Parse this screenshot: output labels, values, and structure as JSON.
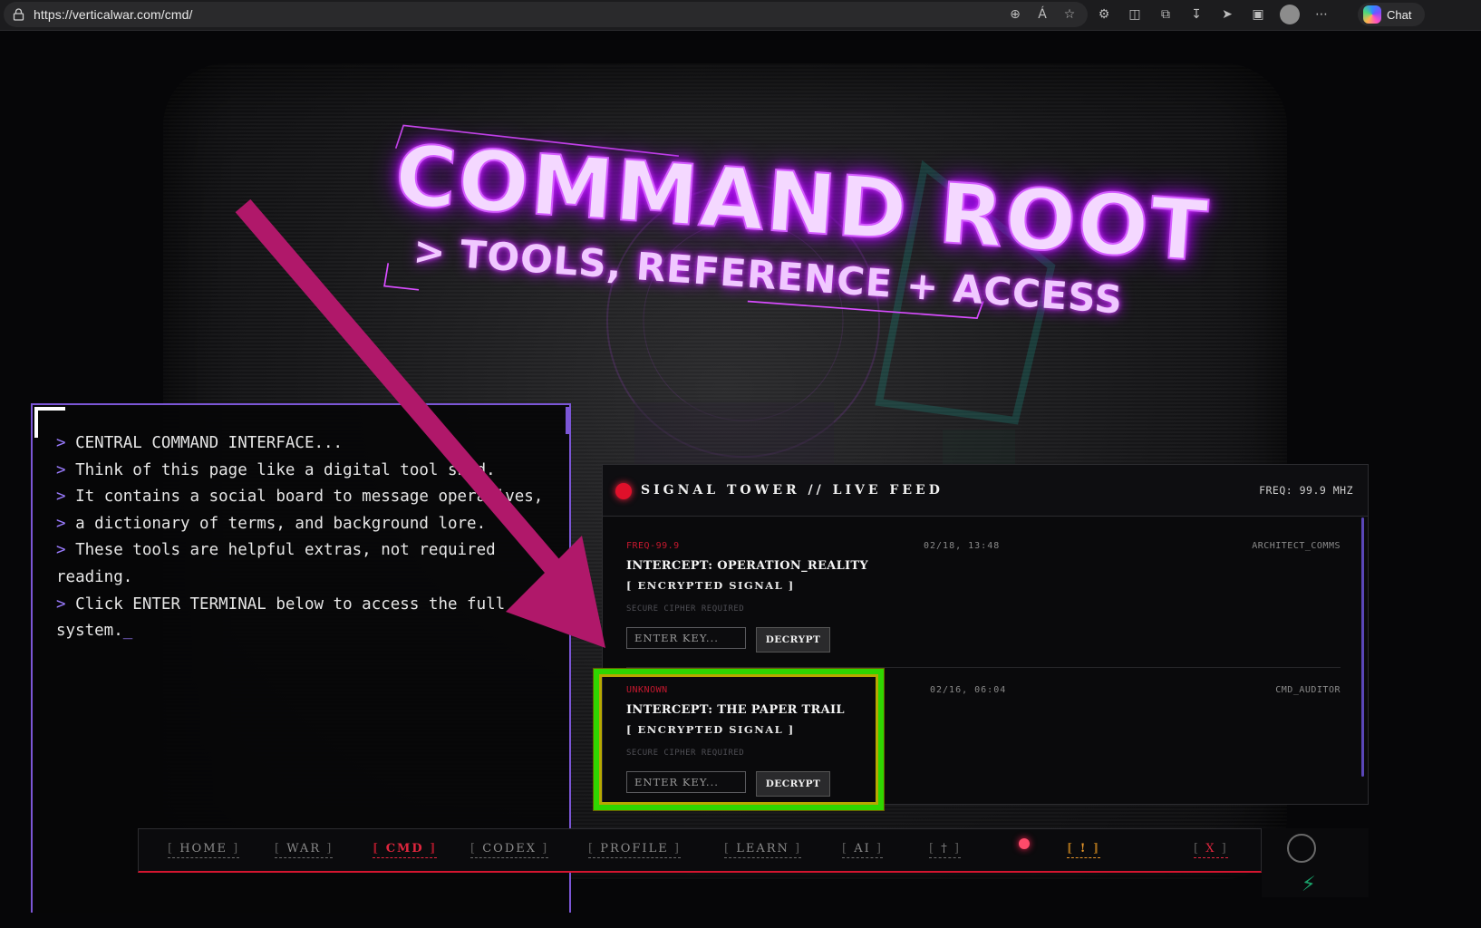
{
  "browser": {
    "url": "https://verticalwar.com/cmd/",
    "chat_label": "Chat",
    "more_label": "⋯"
  },
  "hero": {
    "title": "COMMAND ROOT",
    "subtitle": "> TOOLS, REFERENCE + ACCESS"
  },
  "terminal": {
    "lines": [
      {
        "prompt": ">",
        "text": " CENTRAL COMMAND INTERFACE..."
      },
      {
        "prompt": ">",
        "text": " Think of this page like a digital tool shed."
      },
      {
        "prompt": ">",
        "text": " It contains a social board to message operatives,"
      },
      {
        "prompt": ">",
        "text": " a dictionary of terms, and background lore."
      },
      {
        "prompt": ">",
        "text": " These tools are helpful extras, not required reading."
      },
      {
        "prompt": ">",
        "text": " Click ENTER TERMINAL below to access the full system."
      }
    ],
    "cursor": "_"
  },
  "signal_tower": {
    "title": "SIGNAL TOWER // LIVE FEED",
    "freq": "FREQ: 99.9 MHZ",
    "intercepts": [
      {
        "freq": "FREQ-99.9",
        "date": "02/18, 13:48",
        "author": "ARCHITECT_COMMS",
        "title": "INTERCEPT: OPERATION_REALITY",
        "status": "[ ENCRYPTED SIGNAL ]",
        "note": "SECURE CIPHER REQUIRED",
        "key_placeholder": "ENTER KEY...",
        "button": "DECRYPT"
      },
      {
        "freq": "UNKNOWN",
        "date": "02/16, 06:04",
        "author": "CMD_AUDITOR",
        "title": "INTERCEPT: THE PAPER TRAIL",
        "status": "[ ENCRYPTED SIGNAL ]",
        "note": "SECURE CIPHER REQUIRED",
        "key_placeholder": "ENTER KEY...",
        "button": "DECRYPT"
      }
    ]
  },
  "nav": {
    "items": [
      {
        "label": "HOME",
        "state": "normal"
      },
      {
        "label": "WAR",
        "state": "normal"
      },
      {
        "label": "CMD",
        "state": "active"
      },
      {
        "label": "CODEX",
        "state": "normal"
      },
      {
        "label": "PROFILE",
        "state": "normal"
      },
      {
        "label": "LEARN",
        "state": "normal"
      },
      {
        "label": "AI",
        "state": "normal"
      },
      {
        "label": "†",
        "state": "normal"
      },
      {
        "label": "!",
        "state": "alert"
      },
      {
        "label": "X",
        "state": "close"
      }
    ],
    "bracket_open": "[",
    "bracket_close": "]"
  },
  "colors": {
    "accent_purple": "#7b56d6",
    "alert_red": "#e0263e",
    "neon_magenta": "#d84dff",
    "highlight_green": "#2fd600",
    "arrow_magenta": "#b0186a"
  }
}
